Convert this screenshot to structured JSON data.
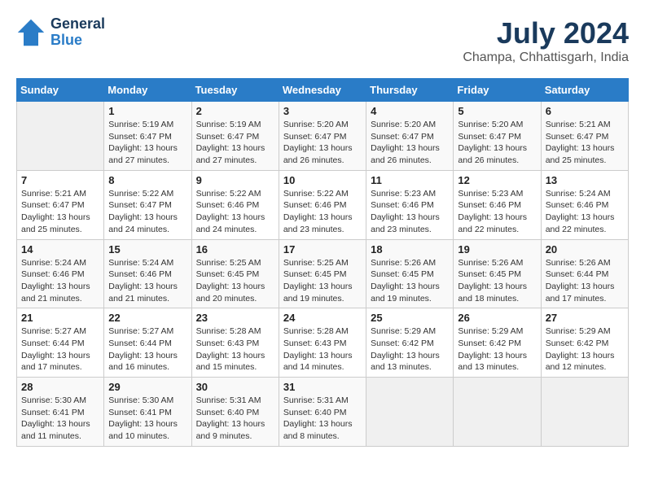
{
  "logo": {
    "line1": "General",
    "line2": "Blue"
  },
  "title": "July 2024",
  "subtitle": "Champa, Chhattisgarh, India",
  "weekdays": [
    "Sunday",
    "Monday",
    "Tuesday",
    "Wednesday",
    "Thursday",
    "Friday",
    "Saturday"
  ],
  "weeks": [
    [
      {
        "day": "",
        "sunrise": "",
        "sunset": "",
        "daylight": ""
      },
      {
        "day": "1",
        "sunrise": "Sunrise: 5:19 AM",
        "sunset": "Sunset: 6:47 PM",
        "daylight": "Daylight: 13 hours and 27 minutes."
      },
      {
        "day": "2",
        "sunrise": "Sunrise: 5:19 AM",
        "sunset": "Sunset: 6:47 PM",
        "daylight": "Daylight: 13 hours and 27 minutes."
      },
      {
        "day": "3",
        "sunrise": "Sunrise: 5:20 AM",
        "sunset": "Sunset: 6:47 PM",
        "daylight": "Daylight: 13 hours and 26 minutes."
      },
      {
        "day": "4",
        "sunrise": "Sunrise: 5:20 AM",
        "sunset": "Sunset: 6:47 PM",
        "daylight": "Daylight: 13 hours and 26 minutes."
      },
      {
        "day": "5",
        "sunrise": "Sunrise: 5:20 AM",
        "sunset": "Sunset: 6:47 PM",
        "daylight": "Daylight: 13 hours and 26 minutes."
      },
      {
        "day": "6",
        "sunrise": "Sunrise: 5:21 AM",
        "sunset": "Sunset: 6:47 PM",
        "daylight": "Daylight: 13 hours and 25 minutes."
      }
    ],
    [
      {
        "day": "7",
        "sunrise": "Sunrise: 5:21 AM",
        "sunset": "Sunset: 6:47 PM",
        "daylight": "Daylight: 13 hours and 25 minutes."
      },
      {
        "day": "8",
        "sunrise": "Sunrise: 5:22 AM",
        "sunset": "Sunset: 6:47 PM",
        "daylight": "Daylight: 13 hours and 24 minutes."
      },
      {
        "day": "9",
        "sunrise": "Sunrise: 5:22 AM",
        "sunset": "Sunset: 6:46 PM",
        "daylight": "Daylight: 13 hours and 24 minutes."
      },
      {
        "day": "10",
        "sunrise": "Sunrise: 5:22 AM",
        "sunset": "Sunset: 6:46 PM",
        "daylight": "Daylight: 13 hours and 23 minutes."
      },
      {
        "day": "11",
        "sunrise": "Sunrise: 5:23 AM",
        "sunset": "Sunset: 6:46 PM",
        "daylight": "Daylight: 13 hours and 23 minutes."
      },
      {
        "day": "12",
        "sunrise": "Sunrise: 5:23 AM",
        "sunset": "Sunset: 6:46 PM",
        "daylight": "Daylight: 13 hours and 22 minutes."
      },
      {
        "day": "13",
        "sunrise": "Sunrise: 5:24 AM",
        "sunset": "Sunset: 6:46 PM",
        "daylight": "Daylight: 13 hours and 22 minutes."
      }
    ],
    [
      {
        "day": "14",
        "sunrise": "Sunrise: 5:24 AM",
        "sunset": "Sunset: 6:46 PM",
        "daylight": "Daylight: 13 hours and 21 minutes."
      },
      {
        "day": "15",
        "sunrise": "Sunrise: 5:24 AM",
        "sunset": "Sunset: 6:46 PM",
        "daylight": "Daylight: 13 hours and 21 minutes."
      },
      {
        "day": "16",
        "sunrise": "Sunrise: 5:25 AM",
        "sunset": "Sunset: 6:45 PM",
        "daylight": "Daylight: 13 hours and 20 minutes."
      },
      {
        "day": "17",
        "sunrise": "Sunrise: 5:25 AM",
        "sunset": "Sunset: 6:45 PM",
        "daylight": "Daylight: 13 hours and 19 minutes."
      },
      {
        "day": "18",
        "sunrise": "Sunrise: 5:26 AM",
        "sunset": "Sunset: 6:45 PM",
        "daylight": "Daylight: 13 hours and 19 minutes."
      },
      {
        "day": "19",
        "sunrise": "Sunrise: 5:26 AM",
        "sunset": "Sunset: 6:45 PM",
        "daylight": "Daylight: 13 hours and 18 minutes."
      },
      {
        "day": "20",
        "sunrise": "Sunrise: 5:26 AM",
        "sunset": "Sunset: 6:44 PM",
        "daylight": "Daylight: 13 hours and 17 minutes."
      }
    ],
    [
      {
        "day": "21",
        "sunrise": "Sunrise: 5:27 AM",
        "sunset": "Sunset: 6:44 PM",
        "daylight": "Daylight: 13 hours and 17 minutes."
      },
      {
        "day": "22",
        "sunrise": "Sunrise: 5:27 AM",
        "sunset": "Sunset: 6:44 PM",
        "daylight": "Daylight: 13 hours and 16 minutes."
      },
      {
        "day": "23",
        "sunrise": "Sunrise: 5:28 AM",
        "sunset": "Sunset: 6:43 PM",
        "daylight": "Daylight: 13 hours and 15 minutes."
      },
      {
        "day": "24",
        "sunrise": "Sunrise: 5:28 AM",
        "sunset": "Sunset: 6:43 PM",
        "daylight": "Daylight: 13 hours and 14 minutes."
      },
      {
        "day": "25",
        "sunrise": "Sunrise: 5:29 AM",
        "sunset": "Sunset: 6:42 PM",
        "daylight": "Daylight: 13 hours and 13 minutes."
      },
      {
        "day": "26",
        "sunrise": "Sunrise: 5:29 AM",
        "sunset": "Sunset: 6:42 PM",
        "daylight": "Daylight: 13 hours and 13 minutes."
      },
      {
        "day": "27",
        "sunrise": "Sunrise: 5:29 AM",
        "sunset": "Sunset: 6:42 PM",
        "daylight": "Daylight: 13 hours and 12 minutes."
      }
    ],
    [
      {
        "day": "28",
        "sunrise": "Sunrise: 5:30 AM",
        "sunset": "Sunset: 6:41 PM",
        "daylight": "Daylight: 13 hours and 11 minutes."
      },
      {
        "day": "29",
        "sunrise": "Sunrise: 5:30 AM",
        "sunset": "Sunset: 6:41 PM",
        "daylight": "Daylight: 13 hours and 10 minutes."
      },
      {
        "day": "30",
        "sunrise": "Sunrise: 5:31 AM",
        "sunset": "Sunset: 6:40 PM",
        "daylight": "Daylight: 13 hours and 9 minutes."
      },
      {
        "day": "31",
        "sunrise": "Sunrise: 5:31 AM",
        "sunset": "Sunset: 6:40 PM",
        "daylight": "Daylight: 13 hours and 8 minutes."
      },
      {
        "day": "",
        "sunrise": "",
        "sunset": "",
        "daylight": ""
      },
      {
        "day": "",
        "sunrise": "",
        "sunset": "",
        "daylight": ""
      },
      {
        "day": "",
        "sunrise": "",
        "sunset": "",
        "daylight": ""
      }
    ]
  ]
}
